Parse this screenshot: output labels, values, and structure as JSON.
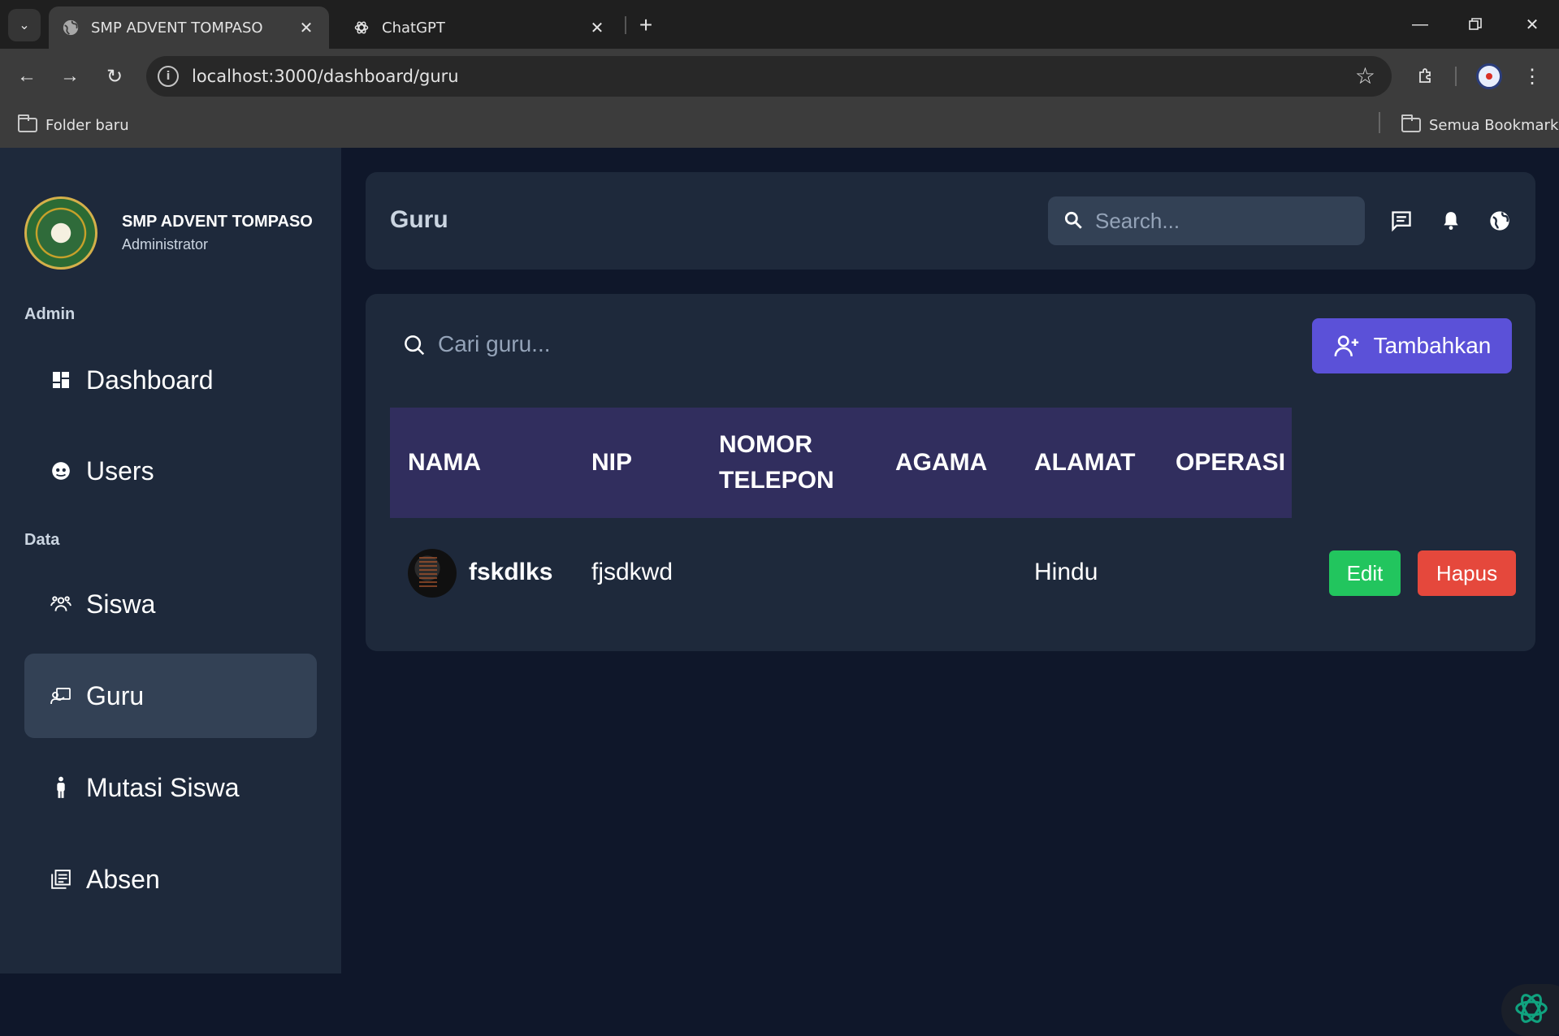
{
  "browser": {
    "tabs": [
      {
        "title": "SMP ADVENT TOMPASO",
        "active": true
      },
      {
        "title": "ChatGPT",
        "active": false
      }
    ],
    "url": "localhost:3000/dashboard/guru",
    "bookmarks": {
      "left": "Folder baru",
      "right": "Semua Bookmark"
    }
  },
  "sidebar": {
    "brand_name": "SMP ADVENT TOMPASO",
    "brand_role": "Administrator",
    "sections": [
      {
        "label": "Admin",
        "items": [
          {
            "label": "Dashboard",
            "icon": "dashboard-icon"
          },
          {
            "label": "Users",
            "icon": "users-icon"
          }
        ]
      },
      {
        "label": "Data",
        "items": [
          {
            "label": "Siswa",
            "icon": "students-icon"
          },
          {
            "label": "Guru",
            "icon": "teacher-icon",
            "active": true
          },
          {
            "label": "Mutasi Siswa",
            "icon": "person-icon"
          },
          {
            "label": "Absen",
            "icon": "attendance-icon"
          }
        ]
      }
    ]
  },
  "header": {
    "title": "Guru",
    "search_placeholder": "Search..."
  },
  "content": {
    "search_placeholder": "Cari guru...",
    "add_label": "Tambahkan",
    "columns": [
      "NAMA",
      "NIP",
      "NOMOR TELEPON",
      "AGAMA",
      "ALAMAT",
      "OPERASI"
    ],
    "rows": [
      {
        "nama": "fskdlks",
        "nip": "fjsdkwd",
        "nomor_telepon": "",
        "agama": "",
        "alamat": "Hindu"
      }
    ],
    "edit_label": "Edit",
    "delete_label": "Hapus"
  },
  "colors": {
    "sidebar_bg": "#1e293b",
    "page_bg": "#0f172a",
    "table_header_bg": "#312e5e",
    "add_button": "#5b51d8",
    "edit_button": "#22c55e",
    "delete_button": "#e5483c"
  }
}
